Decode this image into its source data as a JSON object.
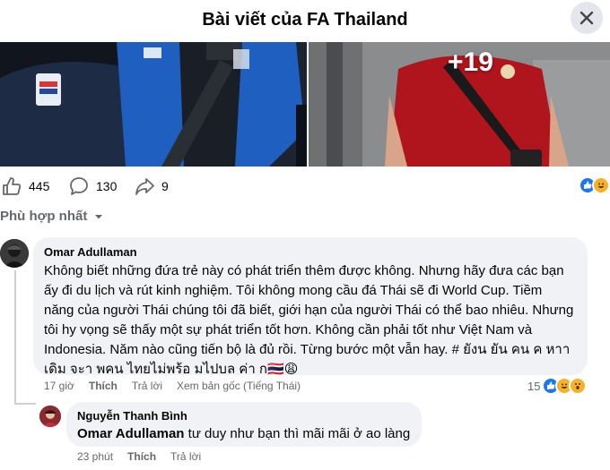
{
  "header": {
    "title": "Bài viết của FA Thailand"
  },
  "photos": {
    "more_count": "+19"
  },
  "stats": {
    "likes": "445",
    "comments": "130",
    "shares": "9"
  },
  "sort": {
    "label": "Phù hợp nhất"
  },
  "comment1": {
    "author": "Omar Adullaman",
    "lines": [
      "Không biết những đứa trẻ này có phát triển thêm được không. Nhưng hãy đưa các bạn",
      "ấy đi du lịch và rút kinh nghiệm. Tôi không mong cầu đá Thái sẽ đi World Cup. Tiềm",
      "năng của người Thái chúng tôi đã biết, giới hạn của người Thái có thể bao nhiêu. Nhưng",
      "tôi hy vọng sẽ thấy một sự phát triển tốt hơn. Không cần phải tốt như Việt Nam và",
      "Indonesia. Năm nào cũng tiến bộ là đủ rồi. Từng bước một vẫn hay. # ยังน ยัน คน ค หาา",
      "เดิม จะา พคน ไทยไม่พร้อ มไปบล ค่า ก🇹🇭😩"
    ],
    "time": "17 giờ",
    "like": "Thích",
    "reply": "Trả lời",
    "translate": "Xem bản gốc (Tiếng Thái)",
    "reaction_count": "15"
  },
  "comment2": {
    "author": "Nguyễn Thanh Bình",
    "mention": "Omar Adullaman",
    "text": " tư duy như bạn thì mãi mãi ở ao làng",
    "time": "23 phút",
    "like": "Thích",
    "reply": "Trả lời"
  },
  "colors": {
    "like_blue": "#1877f2",
    "haha_yellow": "#f7b125",
    "text_secondary": "#65676b",
    "bubble_bg": "#f0f2f5"
  }
}
